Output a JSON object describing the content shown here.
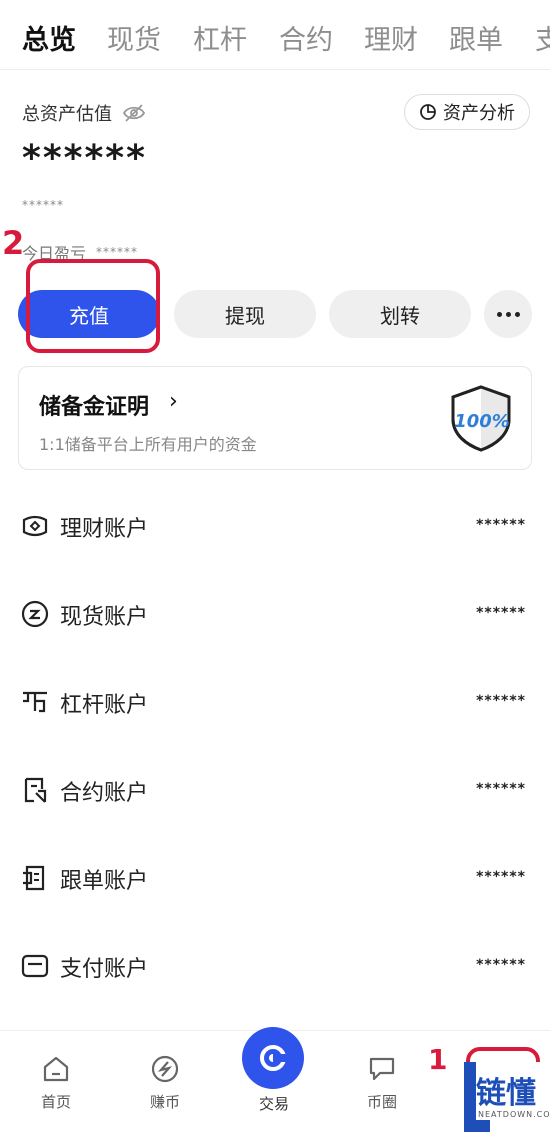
{
  "tabs": [
    "总览",
    "现货",
    "杠杆",
    "合约",
    "理财",
    "跟单",
    "支"
  ],
  "asset": {
    "label": "总资产估值",
    "analysis_button": "资产分析",
    "value": "******",
    "sub_value": "******",
    "pnl_label": "今日盈亏",
    "pnl_value": "******"
  },
  "actions": {
    "deposit": "充值",
    "withdraw": "提现",
    "transfer": "划转"
  },
  "annotations": {
    "step1": "1",
    "step2": "2"
  },
  "reserve": {
    "title": "储备金证明",
    "chevron": "›",
    "desc": "1:1储备平台上所有用户的资金",
    "badge": "100%"
  },
  "accounts": [
    {
      "label": "理财账户",
      "value": "******",
      "icon": "finance-icon"
    },
    {
      "label": "现货账户",
      "value": "******",
      "icon": "spot-icon"
    },
    {
      "label": "杠杆账户",
      "value": "******",
      "icon": "margin-icon"
    },
    {
      "label": "合约账户",
      "value": "******",
      "icon": "futures-icon"
    },
    {
      "label": "跟单账户",
      "value": "******",
      "icon": "copy-trade-icon"
    },
    {
      "label": "支付账户",
      "value": "******",
      "icon": "payment-icon"
    }
  ],
  "nav": {
    "home": "首页",
    "earn": "赚币",
    "trade": "交易",
    "community": "币圈"
  },
  "watermark": {
    "text": "链懂",
    "sub": "NEATDOWN.COM",
    "letter": "L"
  },
  "colors": {
    "accent": "#2f54eb",
    "annotation": "#d81b3c",
    "watermark": "#1e4fb8"
  }
}
